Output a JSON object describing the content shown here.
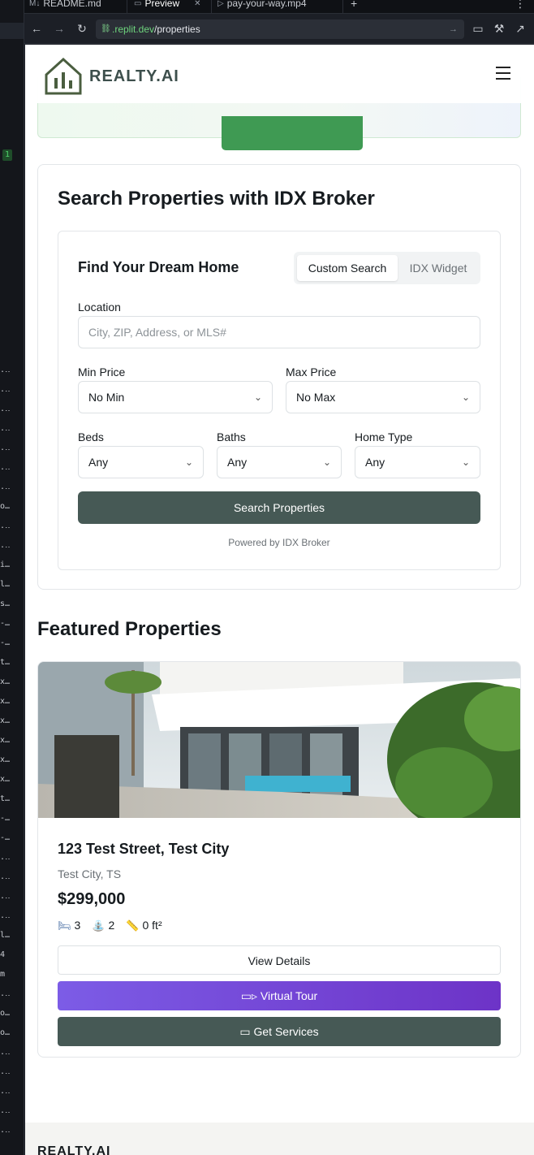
{
  "browser": {
    "tabs": [
      {
        "label": "README.md",
        "icon": "markdown-icon"
      },
      {
        "label": "Preview",
        "icon": "monitor-icon",
        "active": true
      },
      {
        "label": "pay-your-way.mp4",
        "icon": "play-icon"
      }
    ],
    "url_host": ".replit.dev",
    "url_path": "/properties",
    "gutter_marker": "1"
  },
  "header": {
    "logo_text": "REALTY.AI",
    "menu_icon": "hamburger-menu-icon"
  },
  "search": {
    "section_title": "Search Properties with IDX Broker",
    "form_title": "Find Your Dream Home",
    "tabs": [
      "Custom Search",
      "IDX Widget"
    ],
    "location_label": "Location",
    "location_placeholder": "City, ZIP, Address, or MLS#",
    "min_price_label": "Min Price",
    "min_price_value": "No Min",
    "max_price_label": "Max Price",
    "max_price_value": "No Max",
    "beds_label": "Beds",
    "beds_value": "Any",
    "baths_label": "Baths",
    "baths_value": "Any",
    "home_type_label": "Home Type",
    "home_type_value": "Any",
    "submit_label": "Search Properties",
    "powered_by": "Powered by IDX Broker"
  },
  "featured": {
    "title": "Featured Properties",
    "properties": [
      {
        "address": "123 Test Street, Test City",
        "city": "Test City, TS",
        "price": "$299,000",
        "beds": "3",
        "baths": "2",
        "sqft": "0 ft²",
        "view_label": "View Details",
        "tour_label": "Virtual Tour",
        "services_label": "Get Services"
      }
    ]
  },
  "footer": {
    "logo_text": "REALTY.AI"
  },
  "colors": {
    "primary": "#465955",
    "accent_green": "#3f9a53",
    "tour_purple": "#7c5ce6"
  }
}
